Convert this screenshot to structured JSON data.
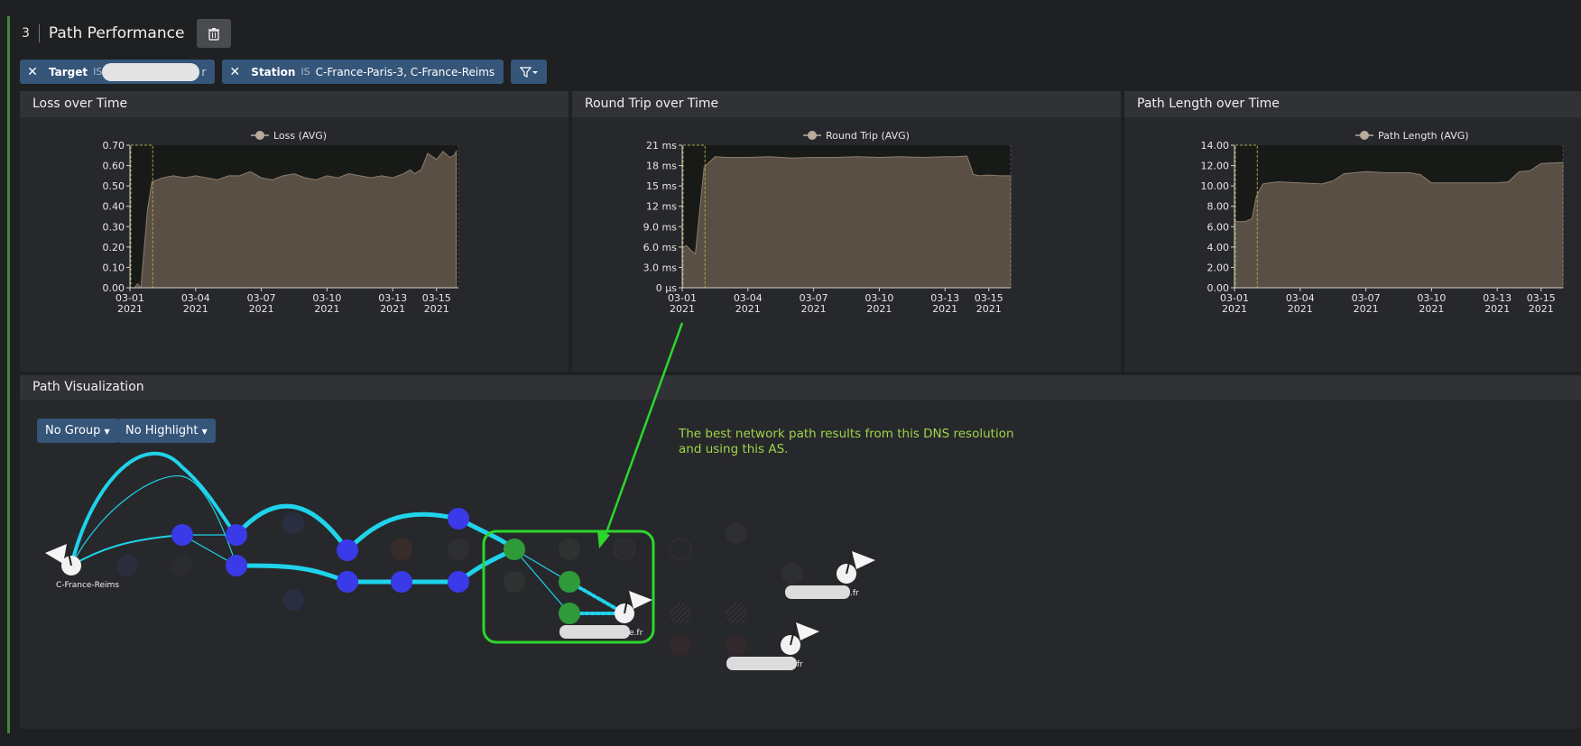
{
  "header": {
    "panel_number": "3",
    "title": "Path Performance",
    "delete_icon": "trash-icon"
  },
  "filters": [
    {
      "key": "Target",
      "op": "IS",
      "value_suffix": "r"
    },
    {
      "key": "Station",
      "op": "IS",
      "value": "C-France-Paris-3,  C-France-Reims"
    }
  ],
  "filter_button_icon": "filter-icon",
  "chart_data": [
    {
      "type": "area",
      "title": "Loss over Time",
      "legend": "Loss (AVG)",
      "x_ticks": [
        "03-01",
        "03-04",
        "03-07",
        "03-10",
        "03-13",
        "03-15"
      ],
      "x_ticks_year": "2021",
      "y_ticks": [
        "0.00",
        "0.10",
        "0.20",
        "0.30",
        "0.40",
        "0.50",
        "0.60",
        "0.70"
      ],
      "ylim": [
        0,
        0.7
      ],
      "x_days": [
        0,
        0.2,
        0.35,
        0.5,
        0.8,
        1,
        1.5,
        2,
        2.5,
        3,
        3.5,
        4,
        4.5,
        5,
        5.5,
        6,
        6.5,
        7,
        7.5,
        8,
        8.5,
        9,
        9.5,
        10,
        10.5,
        11,
        11.5,
        12,
        12.5,
        12.8,
        13,
        13.3,
        13.6,
        14,
        14.3,
        14.6,
        14.8,
        14.9
      ],
      "values": [
        0.0,
        0.0,
        0.02,
        0.0,
        0.38,
        0.52,
        0.54,
        0.55,
        0.54,
        0.55,
        0.54,
        0.53,
        0.55,
        0.55,
        0.57,
        0.54,
        0.53,
        0.55,
        0.56,
        0.54,
        0.53,
        0.55,
        0.54,
        0.56,
        0.55,
        0.54,
        0.55,
        0.54,
        0.56,
        0.58,
        0.56,
        0.58,
        0.66,
        0.63,
        0.67,
        0.64,
        0.65,
        0.67
      ]
    },
    {
      "type": "area",
      "title": "Round Trip over Time",
      "legend": "Round Trip (AVG)",
      "x_ticks": [
        "03-01",
        "03-04",
        "03-07",
        "03-10",
        "03-13",
        "03-15"
      ],
      "x_ticks_year": "2021",
      "y_ticks": [
        "0 µs",
        "3.0 ms",
        "6.0 ms",
        "9.0 ms",
        "12 ms",
        "15 ms",
        "18 ms",
        "21 ms"
      ],
      "ylim": [
        0,
        21
      ],
      "x_days": [
        0,
        0.2,
        0.4,
        0.6,
        1,
        1.5,
        2,
        3,
        4,
        5,
        6,
        7,
        8,
        9,
        10,
        11,
        12,
        12.5,
        13,
        13.3,
        13.6,
        14,
        14.5,
        15
      ],
      "values": [
        6.0,
        6.2,
        5.5,
        5.0,
        17.8,
        19.3,
        19.2,
        19.2,
        19.3,
        19.1,
        19.2,
        19.2,
        19.3,
        19.2,
        19.3,
        19.2,
        19.3,
        19.3,
        19.4,
        16.7,
        16.5,
        16.6,
        16.5,
        16.5
      ]
    },
    {
      "type": "area",
      "title": "Path Length over Time",
      "legend": "Path Length (AVG)",
      "x_ticks": [
        "03-01",
        "03-04",
        "03-07",
        "03-10",
        "03-13",
        "03-15"
      ],
      "x_ticks_year": "2021",
      "y_ticks": [
        "0.00",
        "2.00",
        "4.00",
        "6.00",
        "8.00",
        "10.00",
        "12.00",
        "14.00"
      ],
      "ylim": [
        0,
        14
      ],
      "x_days": [
        0,
        0.5,
        0.8,
        1,
        1.3,
        1.6,
        2,
        3,
        4,
        4.5,
        5,
        6,
        7,
        8,
        8.5,
        9,
        10,
        11,
        11.5,
        12,
        12.5,
        12.8,
        13,
        13.5,
        14,
        15
      ],
      "values": [
        6.5,
        6.5,
        6.8,
        9.0,
        10.2,
        10.3,
        10.4,
        10.3,
        10.2,
        10.5,
        11.2,
        11.4,
        11.3,
        11.3,
        11.1,
        10.3,
        10.3,
        10.3,
        10.3,
        10.3,
        10.4,
        11.0,
        11.4,
        11.5,
        12.2,
        12.3
      ]
    }
  ],
  "viz": {
    "title": "Path Visualization",
    "group_label": "No Group",
    "highlight_label": "No Highlight",
    "annotation": "The best network path results from this DNS resolution and using this AS.",
    "source_label": "C-France-Reims",
    "dest_suffix": ".fr",
    "dest_suffix_2": "e.fr"
  }
}
